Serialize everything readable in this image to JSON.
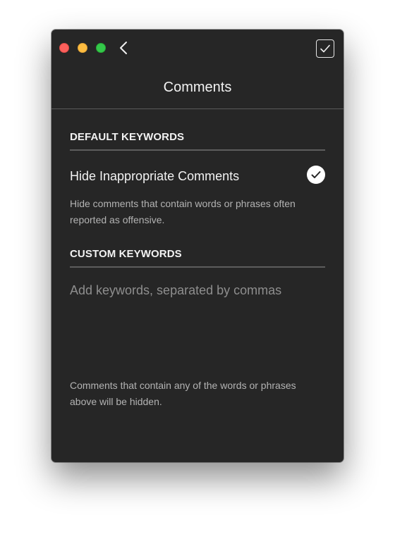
{
  "window": {
    "title": "Comments"
  },
  "toolbar": {
    "back_icon": "chevron-left-icon",
    "done_icon": "checkmark-square-icon"
  },
  "default_keywords": {
    "section_title": "DEFAULT KEYWORDS",
    "option_label": "Hide Inappropriate Comments",
    "option_checked": true,
    "description": "Hide comments that contain words or phrases often reported as offensive."
  },
  "custom_keywords": {
    "section_title": "CUSTOM KEYWORDS",
    "input_value": "",
    "input_placeholder": "Add keywords, separated by commas",
    "footer_note": "Comments that contain any of the words or phrases above will be hidden."
  },
  "colors": {
    "window_bg": "#262626",
    "close": "#fc605c",
    "minimize": "#fdbc40",
    "maximize": "#34c84a"
  }
}
